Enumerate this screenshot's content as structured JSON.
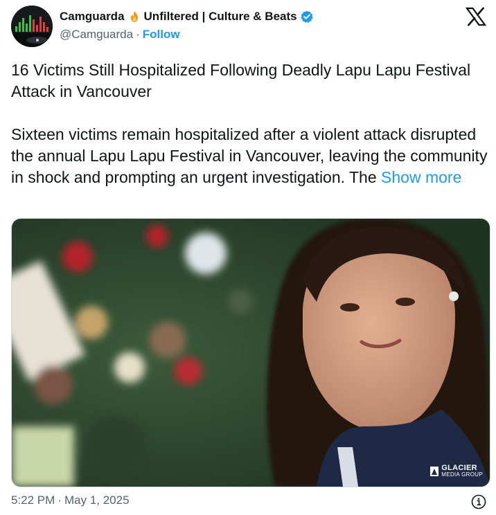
{
  "author": {
    "name_part1": "Camguarda",
    "name_part2": "Unfiltered | Culture & Beats",
    "handle": "@Camguarda",
    "separator": "·",
    "follow_label": "Follow",
    "emoji": "fire-icon",
    "verified": "verified-badge-icon"
  },
  "platform": {
    "logo": "x-logo-icon"
  },
  "post": {
    "headline": "16 Victims Still Hospitalized Following Deadly Lapu Lapu Festival Attack in Vancouver",
    "body": "Sixteen victims remain hospitalized after a violent attack disrupted the annual Lapu Lapu Festival in Vancouver, leaving the community in shock and prompting an urgent investigation. The",
    "show_more": "Show more"
  },
  "media": {
    "watermark_line1": "GLACIER",
    "watermark_line2": "MEDIA GROUP"
  },
  "footer": {
    "time": "5:22 PM",
    "separator": "·",
    "date": "May 1, 2025",
    "info_icon": "info-icon"
  },
  "colors": {
    "link": "#1d9bf0",
    "text": "#0f1419",
    "muted": "#536471",
    "verified": "#1d9bf0"
  }
}
